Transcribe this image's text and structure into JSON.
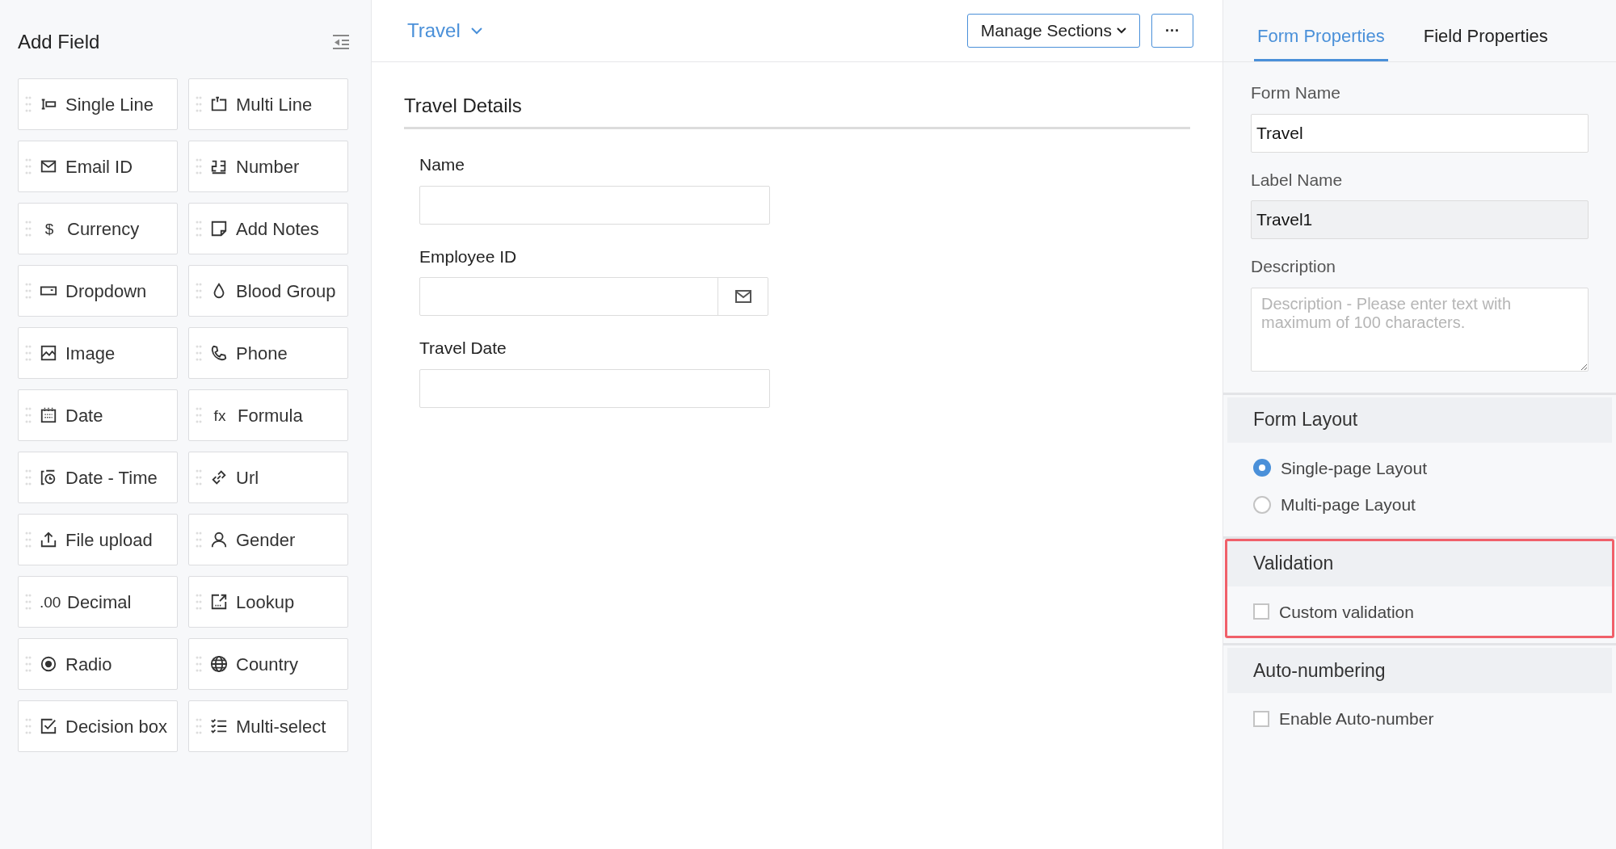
{
  "add_field": {
    "title": "Add Field",
    "fields": [
      {
        "label": "Single Line",
        "kind": "singleline"
      },
      {
        "label": "Multi Line",
        "kind": "multiline"
      },
      {
        "label": "Email ID",
        "kind": "email"
      },
      {
        "label": "Number",
        "kind": "number"
      },
      {
        "label": "Currency",
        "kind": "glyph",
        "glyph": "$"
      },
      {
        "label": "Add Notes",
        "kind": "notes"
      },
      {
        "label": "Dropdown",
        "kind": "dropdown"
      },
      {
        "label": "Blood Group",
        "kind": "drop"
      },
      {
        "label": "Image",
        "kind": "image"
      },
      {
        "label": "Phone",
        "kind": "phone"
      },
      {
        "label": "Date",
        "kind": "date"
      },
      {
        "label": "Formula",
        "kind": "glyph",
        "glyph": "fx"
      },
      {
        "label": "Date - Time",
        "kind": "datetime"
      },
      {
        "label": "Url",
        "kind": "link"
      },
      {
        "label": "File upload",
        "kind": "upload"
      },
      {
        "label": "Gender",
        "kind": "person"
      },
      {
        "label": "Decimal",
        "kind": "glyph",
        "glyph": ".00"
      },
      {
        "label": "Lookup",
        "kind": "lookup"
      },
      {
        "label": "Radio",
        "kind": "radio"
      },
      {
        "label": "Country",
        "kind": "globe"
      },
      {
        "label": "Decision box",
        "kind": "checkbox"
      },
      {
        "label": "Multi-select",
        "kind": "checklist"
      }
    ]
  },
  "form": {
    "name": "Travel",
    "section_title": "Travel Details",
    "fields": [
      {
        "label": "Name",
        "kind": "text"
      },
      {
        "label": "Employee ID",
        "kind": "email"
      },
      {
        "label": "Travel Date",
        "kind": "text"
      }
    ]
  },
  "toolbar": {
    "manage_sections": "Manage Sections",
    "more": "···"
  },
  "properties": {
    "tabs": [
      {
        "label": "Form Properties",
        "selected": true
      },
      {
        "label": "Field Properties",
        "selected": false
      }
    ],
    "form_name": {
      "label": "Form Name",
      "value": "Travel"
    },
    "label_name": {
      "label": "Label Name",
      "value": "Travel1"
    },
    "description": {
      "label": "Description",
      "placeholder": "Description - Please enter text with maximum of 100 characters."
    },
    "sections": [
      {
        "title": "Form Layout",
        "highlighted": false,
        "options": [
          {
            "kind": "radio",
            "label": "Single-page Layout",
            "checked": true
          },
          {
            "kind": "radio",
            "label": "Multi-page Layout",
            "checked": false
          }
        ]
      },
      {
        "title": "Validation",
        "highlighted": true,
        "options": [
          {
            "kind": "checkbox",
            "label": "Custom validation",
            "checked": false
          }
        ]
      },
      {
        "title": "Auto-numbering",
        "highlighted": false,
        "options": [
          {
            "kind": "checkbox",
            "label": "Enable Auto-number",
            "checked": false
          }
        ]
      }
    ]
  }
}
